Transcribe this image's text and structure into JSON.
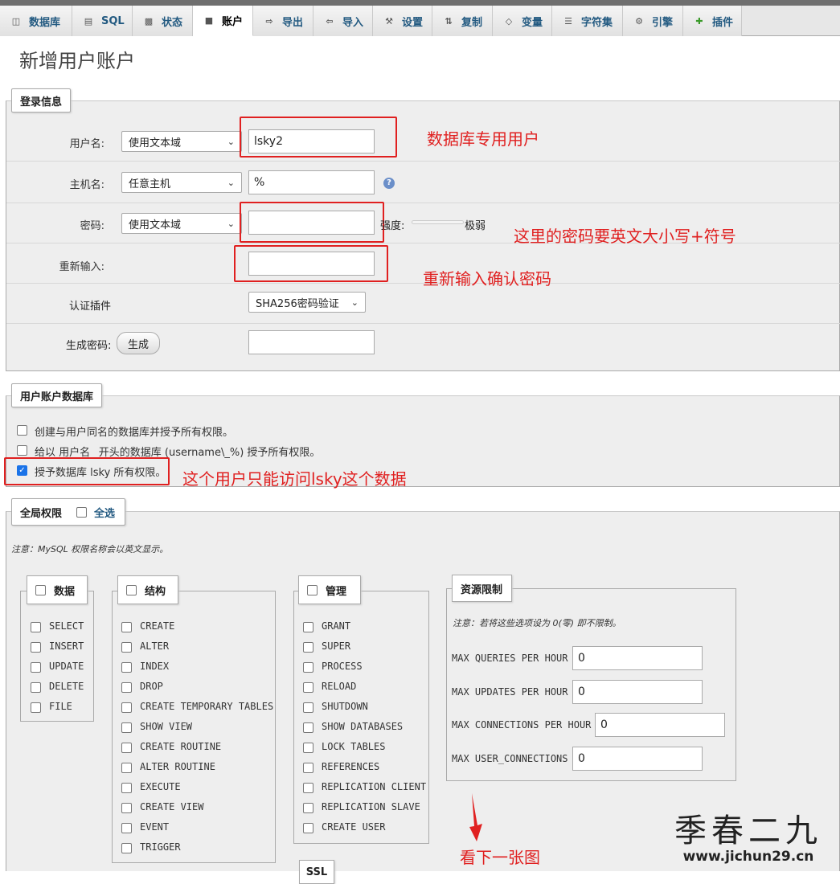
{
  "tabs": [
    {
      "label": "数据库",
      "icon": "database-icon"
    },
    {
      "label": "SQL",
      "icon": "sql-icon"
    },
    {
      "label": "状态",
      "icon": "status-icon"
    },
    {
      "label": "账户",
      "icon": "accounts-icon",
      "active": true
    },
    {
      "label": "导出",
      "icon": "export-icon"
    },
    {
      "label": "导入",
      "icon": "import-icon"
    },
    {
      "label": "设置",
      "icon": "settings-icon"
    },
    {
      "label": "复制",
      "icon": "replication-icon"
    },
    {
      "label": "变量",
      "icon": "variables-icon"
    },
    {
      "label": "字符集",
      "icon": "charset-icon"
    },
    {
      "label": "引擎",
      "icon": "engine-icon"
    },
    {
      "label": "插件",
      "icon": "plugin-icon"
    }
  ],
  "page_title": "新增用户账户",
  "login": {
    "legend": "登录信息",
    "username_label": "用户名:",
    "username_type": "使用文本域",
    "username_value": "lsky2",
    "host_label": "主机名:",
    "host_type": "任意主机",
    "host_value": "%",
    "password_label": "密码:",
    "password_type": "使用文本域",
    "password_value": "",
    "strength_label": "强度:",
    "strength_text": "极弱",
    "retype_label": "重新输入:",
    "retype_value": "",
    "auth_label": "认证插件",
    "auth_value": "SHA256密码验证",
    "generate_label": "生成密码:",
    "generate_button": "生成",
    "generated_value": ""
  },
  "annotations": {
    "username_note": "数据库专用用户",
    "password_note": "这里的密码要英文大小写+符号",
    "retype_note": "重新输入确认密码",
    "db_note": "这个用户只能访问lsky这个数据",
    "next_note": "看下一张图"
  },
  "userdb": {
    "legend": "用户账户数据库",
    "options": [
      {
        "label": "创建与用户同名的数据库并授予所有权限。",
        "checked": false
      },
      {
        "label": "给以 用户名_ 开头的数据库 (username\\_%) 授予所有权限。",
        "checked": false
      },
      {
        "label": "授予数据库 lsky 所有权限。",
        "checked": true
      }
    ]
  },
  "global": {
    "legend": "全局权限",
    "select_all": "全选",
    "note": "注意：MySQL 权限名称会以英文显示。",
    "groups": [
      {
        "title": "数据",
        "items": [
          "SELECT",
          "INSERT",
          "UPDATE",
          "DELETE",
          "FILE"
        ]
      },
      {
        "title": "结构",
        "items": [
          "CREATE",
          "ALTER",
          "INDEX",
          "DROP",
          "CREATE TEMPORARY TABLES",
          "SHOW VIEW",
          "CREATE ROUTINE",
          "ALTER ROUTINE",
          "EXECUTE",
          "CREATE VIEW",
          "EVENT",
          "TRIGGER"
        ]
      },
      {
        "title": "管理",
        "items": [
          "GRANT",
          "SUPER",
          "PROCESS",
          "RELOAD",
          "SHUTDOWN",
          "SHOW DATABASES",
          "LOCK TABLES",
          "REFERENCES",
          "REPLICATION CLIENT",
          "REPLICATION SLAVE",
          "CREATE USER"
        ]
      }
    ],
    "resources": {
      "title": "资源限制",
      "note": "注意：若将这些选项设为 0(零) 即不限制。",
      "limits": [
        {
          "label": "MAX QUERIES PER HOUR",
          "value": "0"
        },
        {
          "label": "MAX UPDATES PER HOUR",
          "value": "0"
        },
        {
          "label": "MAX CONNECTIONS PER HOUR",
          "value": "0"
        },
        {
          "label": "MAX USER_CONNECTIONS",
          "value": "0"
        }
      ]
    },
    "ssl_legend": "SSL"
  },
  "watermark": {
    "title": "季春二九",
    "url": "www.jichun29.cn"
  },
  "colors": {
    "annotation": "#e02020",
    "tab_text": "#235a81",
    "checkbox_on": "#1a73e8"
  }
}
